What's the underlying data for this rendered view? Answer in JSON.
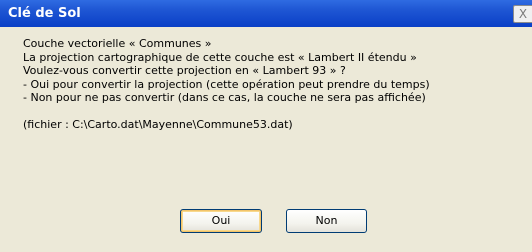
{
  "window": {
    "title": "Clé de Sol",
    "close_label": "X"
  },
  "message": {
    "lines": [
      "Couche vectorielle « Communes »",
      "La projection cartographique de cette couche est « Lambert II étendu »",
      "Voulez-vous convertir cette projection en « Lambert 93 » ?",
      "- Oui pour convertir la projection (cette opération peut prendre du temps)",
      "- Non pour ne pas convertir (dans ce cas, la couche ne sera pas affichée)"
    ],
    "file_line": "(fichier : C:\\Carto.dat\\Mayenne\\Commune53.dat)"
  },
  "buttons": {
    "yes_label": "Oui",
    "no_label": "Non"
  },
  "colors": {
    "titlebar": "#0A3FC6",
    "dialog_bg": "#ECE9D8",
    "focus_ring": "#F2C46B"
  }
}
